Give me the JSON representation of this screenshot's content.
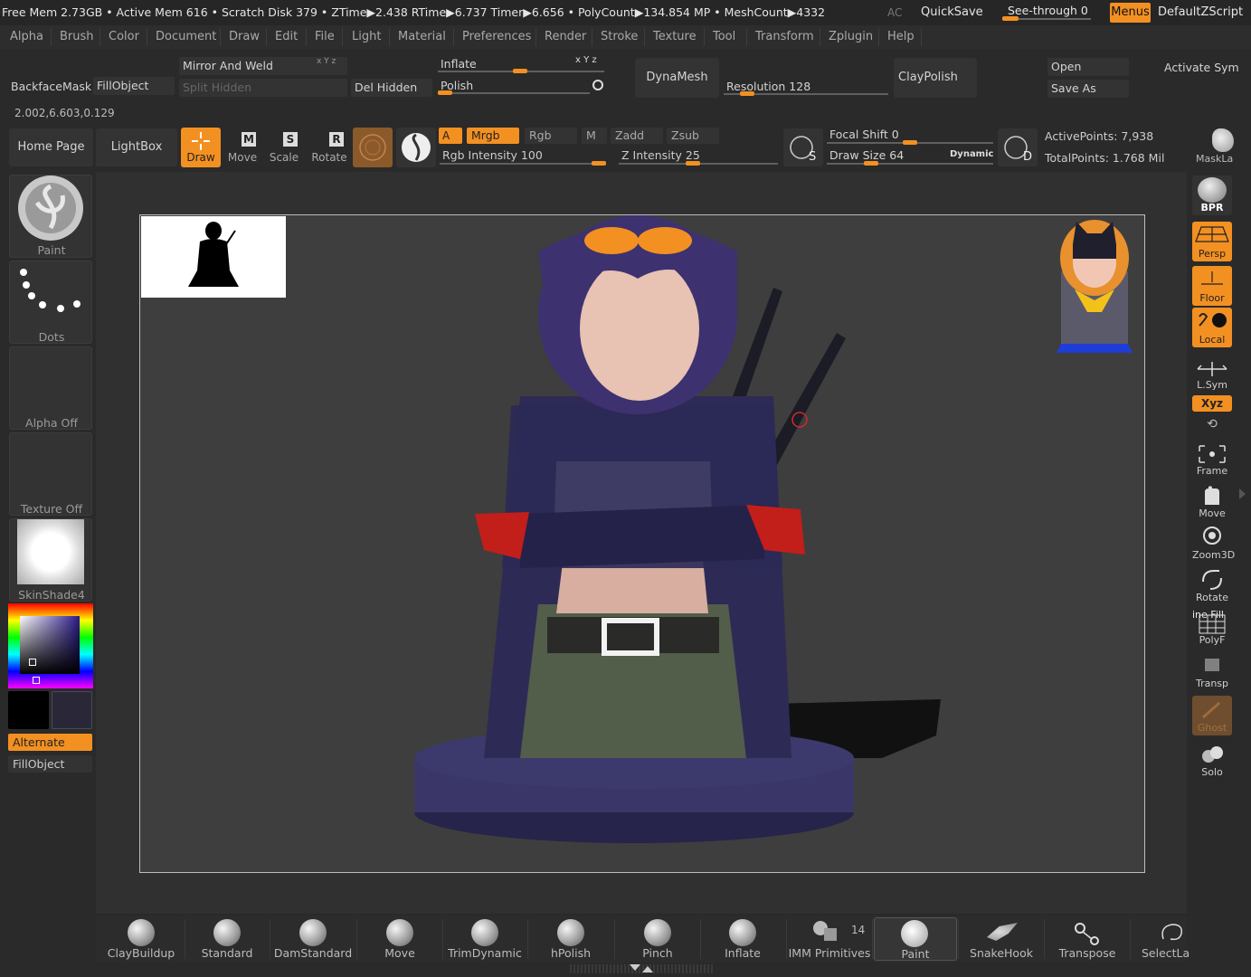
{
  "status_bar": {
    "text": "Free Mem 2.73GB • Active Mem 616 • Scratch Disk 379 •  ZTime▶2.438 RTime▶6.737 Timer▶6.656 • PolyCount▶134.854 MP  • MeshCount▶4332",
    "ac": "AC",
    "quicksave": "QuickSave",
    "see_through": "See-through   0",
    "menus": "Menus",
    "default_zscript": "DefaultZScript"
  },
  "menu_bar": [
    "Alpha",
    "Brush",
    "Color",
    "Document",
    "Draw",
    "Edit",
    "File",
    "Light",
    "Material",
    "Preferences",
    "Render",
    "Stroke",
    "Texture",
    "Tool",
    "Transform",
    "Zplugin",
    "Help"
  ],
  "row1": {
    "backface_mask": "BackfaceMask",
    "fill_object": "FillObject",
    "mirror_and_weld": "Mirror And Weld",
    "split_hidden": "Split Hidden",
    "del_hidden": "Del Hidden",
    "inflate": "Inflate",
    "xyz": "x Y z",
    "polish": "Polish",
    "dynamesh": "DynaMesh",
    "resolution": "Resolution 128",
    "claypolish": "ClayPolish",
    "open": "Open",
    "save_as": "Save As",
    "activate_sym": "Activate Sym"
  },
  "coords": "2.002,6.603,0.129",
  "row2": {
    "home_page": "Home Page",
    "lightbox": "LightBox",
    "draw": "Draw",
    "move": "Move",
    "scale": "Scale",
    "rotate": "Rotate",
    "a": "A",
    "mrgb": "Mrgb",
    "rgb": "Rgb",
    "m": "M",
    "zadd": "Zadd",
    "zsub": "Zsub",
    "rgb_intensity": "Rgb Intensity 100",
    "z_intensity": "Z Intensity 25",
    "focal_shift": "Focal Shift 0",
    "draw_size": "Draw Size 64",
    "dynamic": "Dynamic",
    "active_points": "ActivePoints: 7,938",
    "total_points": "TotalPoints: 1.768 Mil",
    "masklasso": "MaskLa"
  },
  "left_panel": {
    "paint": "Paint",
    "dots": "Dots",
    "alpha_off": "Alpha Off",
    "texture_off": "Texture Off",
    "skinshade": "SkinShade4",
    "alternate": "Alternate",
    "fill_object": "FillObject"
  },
  "right_shelf": [
    "BPR",
    "Persp",
    "Floor",
    "Local",
    "L.Sym",
    "Xyz",
    "Frame",
    "Move",
    "Zoom3D",
    "Rotate",
    "PolyF",
    "Transp",
    "Ghost",
    "Solo"
  ],
  "right_shelf_extra": "ine Fill",
  "brushes": [
    "ClayBuildup",
    "Standard",
    "DamStandard",
    "Move",
    "TrimDynamic",
    "hPolish",
    "Pinch",
    "Inflate",
    "IMM Primitives",
    "Paint",
    "SnakeHook",
    "Transpose",
    "SelectLa"
  ],
  "imm_count": "14",
  "colors": {
    "accent": "#f39022",
    "background": "#2a2a2a",
    "canvas": "#3e3e3e"
  }
}
